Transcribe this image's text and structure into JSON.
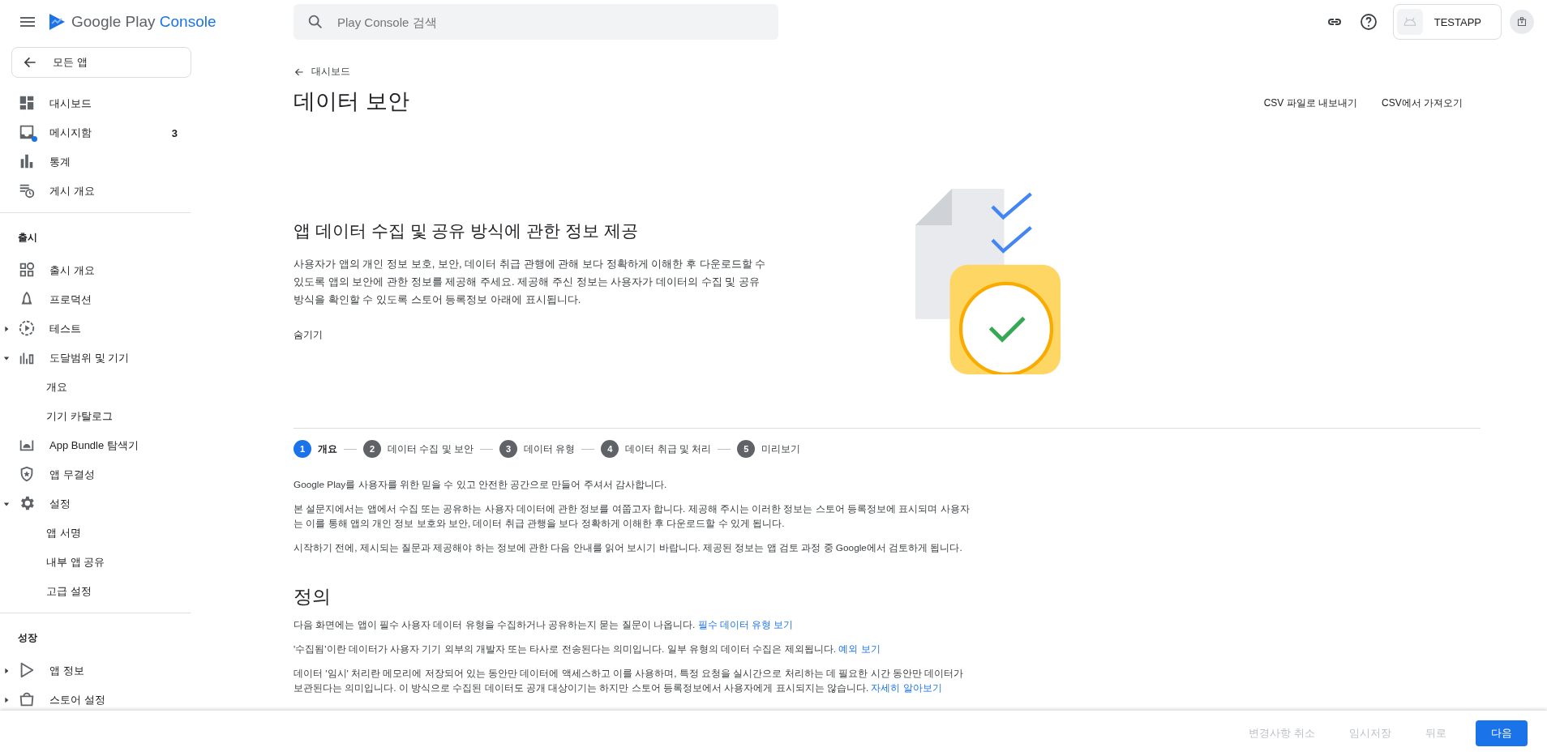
{
  "app_bar": {
    "logo_text": "Google Play",
    "logo_accent": "Console",
    "search": {
      "placeholder": "Play Console 검색"
    },
    "app_name": "TESTAPP"
  },
  "sidebar": {
    "back_button": "모든 앱",
    "sections": [
      {
        "items": [
          {
            "label": "대시보드"
          },
          {
            "label": "메시지함",
            "count": "3",
            "unread": true
          },
          {
            "label": "통계"
          },
          {
            "label": "게시 개요"
          }
        ]
      },
      {
        "title": "출시",
        "items": [
          {
            "label": "출시 개요"
          },
          {
            "label": "프로덕션"
          },
          {
            "label": "테스트",
            "expanded": false
          },
          {
            "label": "도달범위 및 기기",
            "expanded": true,
            "children": [
              {
                "label": "개요"
              },
              {
                "label": "기기 카탈로그"
              }
            ]
          },
          {
            "label": "App Bundle 탐색기"
          },
          {
            "label": "앱 무결성"
          },
          {
            "label": "설정",
            "expanded": true,
            "children": [
              {
                "label": "앱 서명"
              },
              {
                "label": "내부 앱 공유"
              },
              {
                "label": "고급 설정"
              }
            ]
          }
        ]
      },
      {
        "title": "성장",
        "items": [
          {
            "label": "앱 정보",
            "expanded": false
          },
          {
            "label": "스토어 설정",
            "expanded": false
          }
        ]
      }
    ]
  },
  "page": {
    "breadcrumb": "대시보드",
    "title": "데이터 보안",
    "actions": [
      "CSV 파일로 내보내기",
      "CSV에서 가져오기"
    ]
  },
  "intro": {
    "heading": "앱 데이터 수집 및 공유 방식에 관한 정보 제공",
    "text": "사용자가 앱의 개인 정보 보호, 보안, 데이터 취급 관행에 관해 보다 정확하게 이해한 후 다운로드할 수 있도록 앱의 보안에 관한 정보를 제공해 주세요. 제공해 주신 정보는 사용자가 데이터의 수집 및 공유 방식을 확인할 수 있도록 스토어 등록정보 아래에 표시됩니다.",
    "hide_link": "숨기기"
  },
  "steps": [
    {
      "number": "1",
      "label": "개요",
      "selected": true
    },
    {
      "number": "2",
      "label": "데이터 수집 및 보안",
      "selected": false
    },
    {
      "number": "3",
      "label": "데이터 유형",
      "selected": false
    },
    {
      "number": "4",
      "label": "데이터 취급 및 처리",
      "selected": false
    },
    {
      "number": "5",
      "label": "미리보기",
      "selected": false
    }
  ],
  "overview": [
    "Google Play를 사용자를 위한 믿을 수 있고 안전한 공간으로 만들어 주셔서 감사합니다.",
    "본 설문지에서는 앱에서 수집 또는 공유하는 사용자 데이터에 관한 정보를 여쭙고자 합니다. 제공해 주시는 이러한 정보는 스토어 등록정보에 표시되며 사용자는 이를 통해 앱의 개인 정보 보호와 보안, 데이터 취급 관행을 보다 정확하게 이해한 후 다운로드할 수 있게 됩니다.",
    "시작하기 전에, 제시되는 질문과 제공해야 하는 정보에 관한 다음 안내를 읽어 보시기 바랍니다. 제공된 정보는 앱 검토 과정 중 Google에서 검토하게 됩니다."
  ],
  "definitions": {
    "heading": "정의",
    "paragraphs": [
      {
        "text": "다음 화면에는 앱이 필수 사용자 데이터 유형을 수집하거나 공유하는지 묻는 질문이 나옵니다.",
        "link": "필수 데이터 유형 보기"
      },
      {
        "text": "'수집됨'이란 데이터가 사용자 기기 외부의 개발자 또는 타사로 전송된다는 의미입니다. 일부 유형의 데이터 수집은 제외됩니다.",
        "link": "예외 보기"
      },
      {
        "text": "데이터 '임시' 처리란 메모리에 저장되어 있는 동안만 데이터에 액세스하고 이를 사용하며, 특정 요청을 실시간으로 처리하는 데 필요한 시간 동안만 데이터가 보관된다는 의미입니다. 이 방식으로 수집된 데이터도 공개 대상이기는 하지만 스토어 등록정보에서 사용자에게 표시되지는 않습니다.",
        "link": "자세히 알아보기"
      }
    ]
  },
  "footer": {
    "buttons": [
      {
        "label": "변경사항 취소",
        "disabled": true,
        "kind": "text"
      },
      {
        "label": "임시저장",
        "disabled": true,
        "kind": "text"
      },
      {
        "label": "뒤로",
        "disabled": true,
        "kind": "text"
      },
      {
        "label": "다음",
        "disabled": false,
        "kind": "primary"
      }
    ]
  }
}
